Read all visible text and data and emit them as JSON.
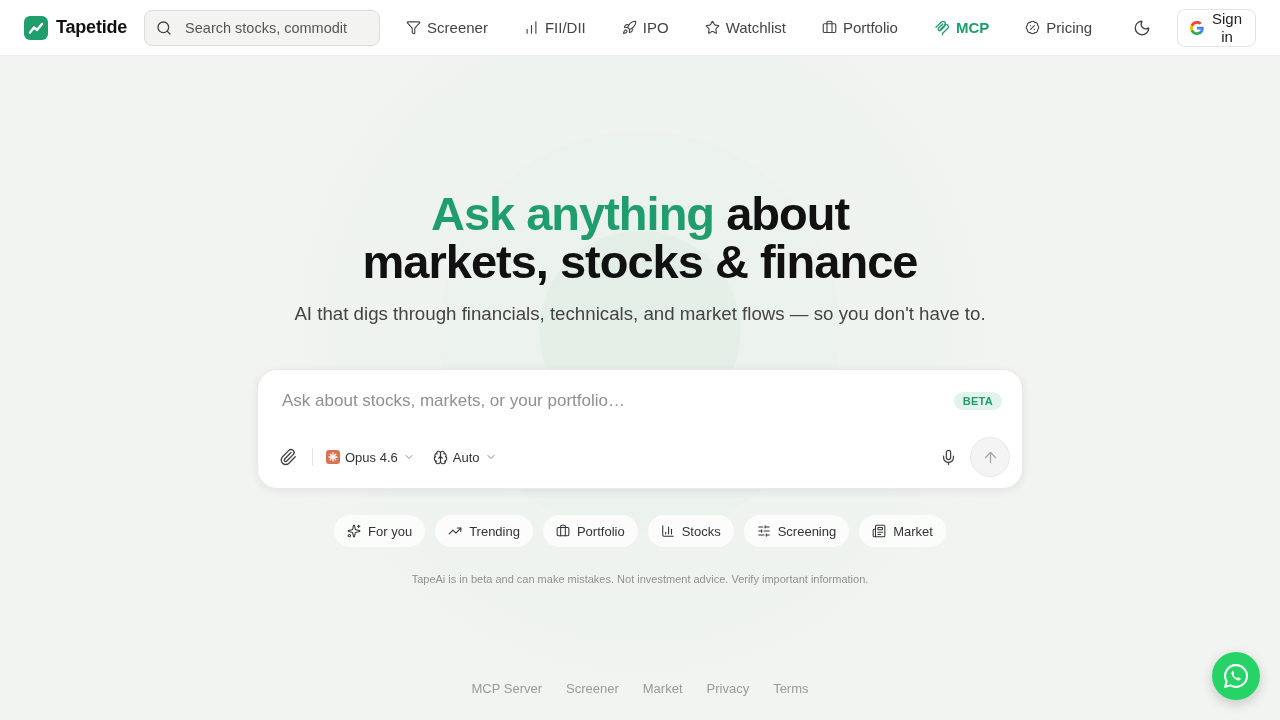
{
  "brand": {
    "name": "Tapetide"
  },
  "search": {
    "placeholder": "Search stocks, commodit"
  },
  "nav": [
    {
      "label": "Screener",
      "selected": false
    },
    {
      "label": "FII/DII",
      "selected": false
    },
    {
      "label": "IPO",
      "selected": false
    },
    {
      "label": "Watchlist",
      "selected": false
    },
    {
      "label": "Portfolio",
      "selected": false
    },
    {
      "label": "MCP",
      "selected": true
    },
    {
      "label": "Pricing",
      "selected": false
    }
  ],
  "sign_in": {
    "label": "Sign in"
  },
  "hero": {
    "title_highlight": "Ask anything",
    "title_rest": "about markets, stocks & finance",
    "subtitle": "AI that digs through financials, technicals, and market flows — so you don't have to."
  },
  "composer": {
    "placeholder": "Ask about stocks, markets, or your portfolio…",
    "badge": "BETA",
    "model": "Opus 4.6",
    "mode": "Auto",
    "send_disabled": true
  },
  "suggestions": [
    "For you",
    "Trending",
    "Portfolio",
    "Stocks",
    "Screening",
    "Market"
  ],
  "disclaimer": "TapeAi is in beta and can make mistakes. Not investment advice. Verify important information.",
  "footer_links": [
    "MCP Server",
    "Screener",
    "Market",
    "Privacy",
    "Terms"
  ]
}
